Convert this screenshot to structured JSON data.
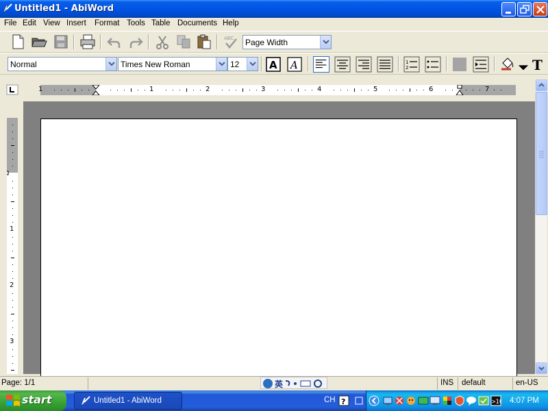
{
  "window": {
    "title": "Untitled1 - AbiWord",
    "icon": "abiword-pen-icon"
  },
  "menu": [
    "File",
    "Edit",
    "View",
    "Insert",
    "Format",
    "Tools",
    "Table",
    "Documents",
    "Help"
  ],
  "toolbar_standard": {
    "zoom_value": "Page Width",
    "icons": [
      "new-document-icon",
      "open-folder-icon",
      "save-icon",
      "print-icon",
      "undo-icon",
      "redo-icon",
      "cut-icon",
      "copy-icon",
      "paste-icon",
      "spellcheck-icon"
    ]
  },
  "toolbar_format": {
    "style_value": "Normal",
    "font_value": "Times New Roman",
    "size_value": "12",
    "icons": [
      "bold-icon",
      "italic-icon",
      "align-left-icon",
      "align-center-icon",
      "align-right-icon",
      "justify-icon",
      "numbered-list-icon",
      "bulleted-list-icon",
      "highlight-color-icon",
      "indent-icon",
      "fill-color-icon",
      "text-color-icon"
    ]
  },
  "ruler": {
    "horizontal_numbers": [
      "1",
      "1",
      "2",
      "3",
      "4",
      "5",
      "6",
      "7"
    ],
    "vertical_numbers": [
      "1",
      "2",
      "3"
    ]
  },
  "statusbar": {
    "page": "Page: 1/1",
    "mode": "INS",
    "language_style": "default",
    "locale": "en-US"
  },
  "taskbar": {
    "start_label": "start",
    "task_label": "Untitled1 - AbiWord",
    "input_lang": "CH",
    "clock": "4:07 PM"
  },
  "colors": {
    "titlebar": "#0055e5",
    "taskbar": "#245edb",
    "start_green": "#38a233",
    "tray": "#0f91e4",
    "doc_background": "#808080"
  }
}
